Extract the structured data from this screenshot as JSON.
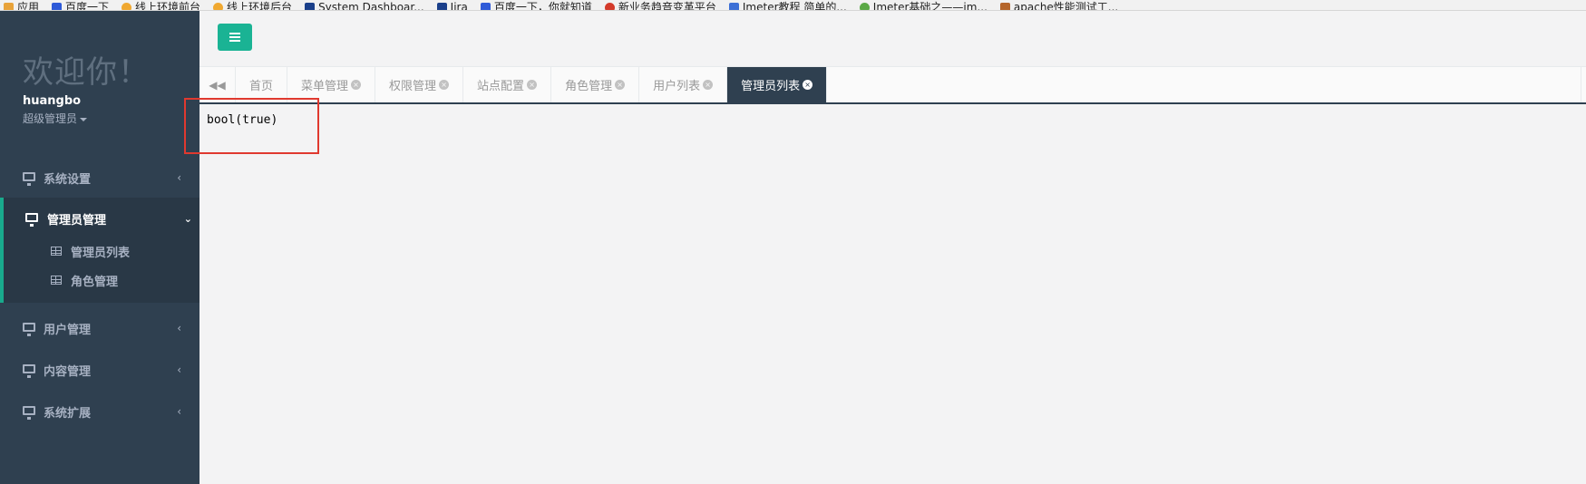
{
  "bookmarks": [
    {
      "label": "应用",
      "color": "#e8a33a"
    },
    {
      "label": "百度一下",
      "color": "#2e5ad8"
    },
    {
      "label": "线上环境前台",
      "color": "#f0a830"
    },
    {
      "label": "线上环境后台",
      "color": "#f0a830"
    },
    {
      "label": "System Dashboar...",
      "color": "#1a3f8a"
    },
    {
      "label": "Jira",
      "color": "#1a3f8a"
    },
    {
      "label": "百度一下，你就知道",
      "color": "#2e5ad8"
    },
    {
      "label": "新业务趋音变革平台",
      "color": "#d33a2a"
    },
    {
      "label": "Jmeter教程 简单的...",
      "color": "#3c6fd6"
    },
    {
      "label": "Jmeter基础之——jm...",
      "color": "#5aa845"
    },
    {
      "label": "apache性能测试工...",
      "color": "#b5652a"
    }
  ],
  "sidebar": {
    "welcome": "欢迎你！",
    "username": "huangbo",
    "role": "超级管理员",
    "items": [
      {
        "label": "系统设置",
        "chevron": "‹"
      },
      {
        "label": "管理员管理",
        "chevron": "⌄"
      },
      {
        "label": "用户管理",
        "chevron": "‹"
      },
      {
        "label": "内容管理",
        "chevron": "‹"
      },
      {
        "label": "系统扩展",
        "chevron": "‹"
      }
    ],
    "sub_items": [
      {
        "label": "管理员列表"
      },
      {
        "label": "角色管理"
      }
    ]
  },
  "tabs": {
    "nav_back": "◀◀",
    "items": [
      {
        "label": "首页"
      },
      {
        "label": "菜单管理",
        "close": "×"
      },
      {
        "label": "权限管理",
        "close": "×"
      },
      {
        "label": "站点配置",
        "close": "×"
      },
      {
        "label": "角色管理",
        "close": "×"
      },
      {
        "label": "用户列表",
        "close": "×"
      },
      {
        "label": "管理员列表",
        "close": "×"
      }
    ]
  },
  "content": {
    "output": "bool(true)"
  },
  "colors": {
    "sidebar_bg": "#2f4050",
    "accent": "#1ab394",
    "highlight": "#e0392f"
  }
}
